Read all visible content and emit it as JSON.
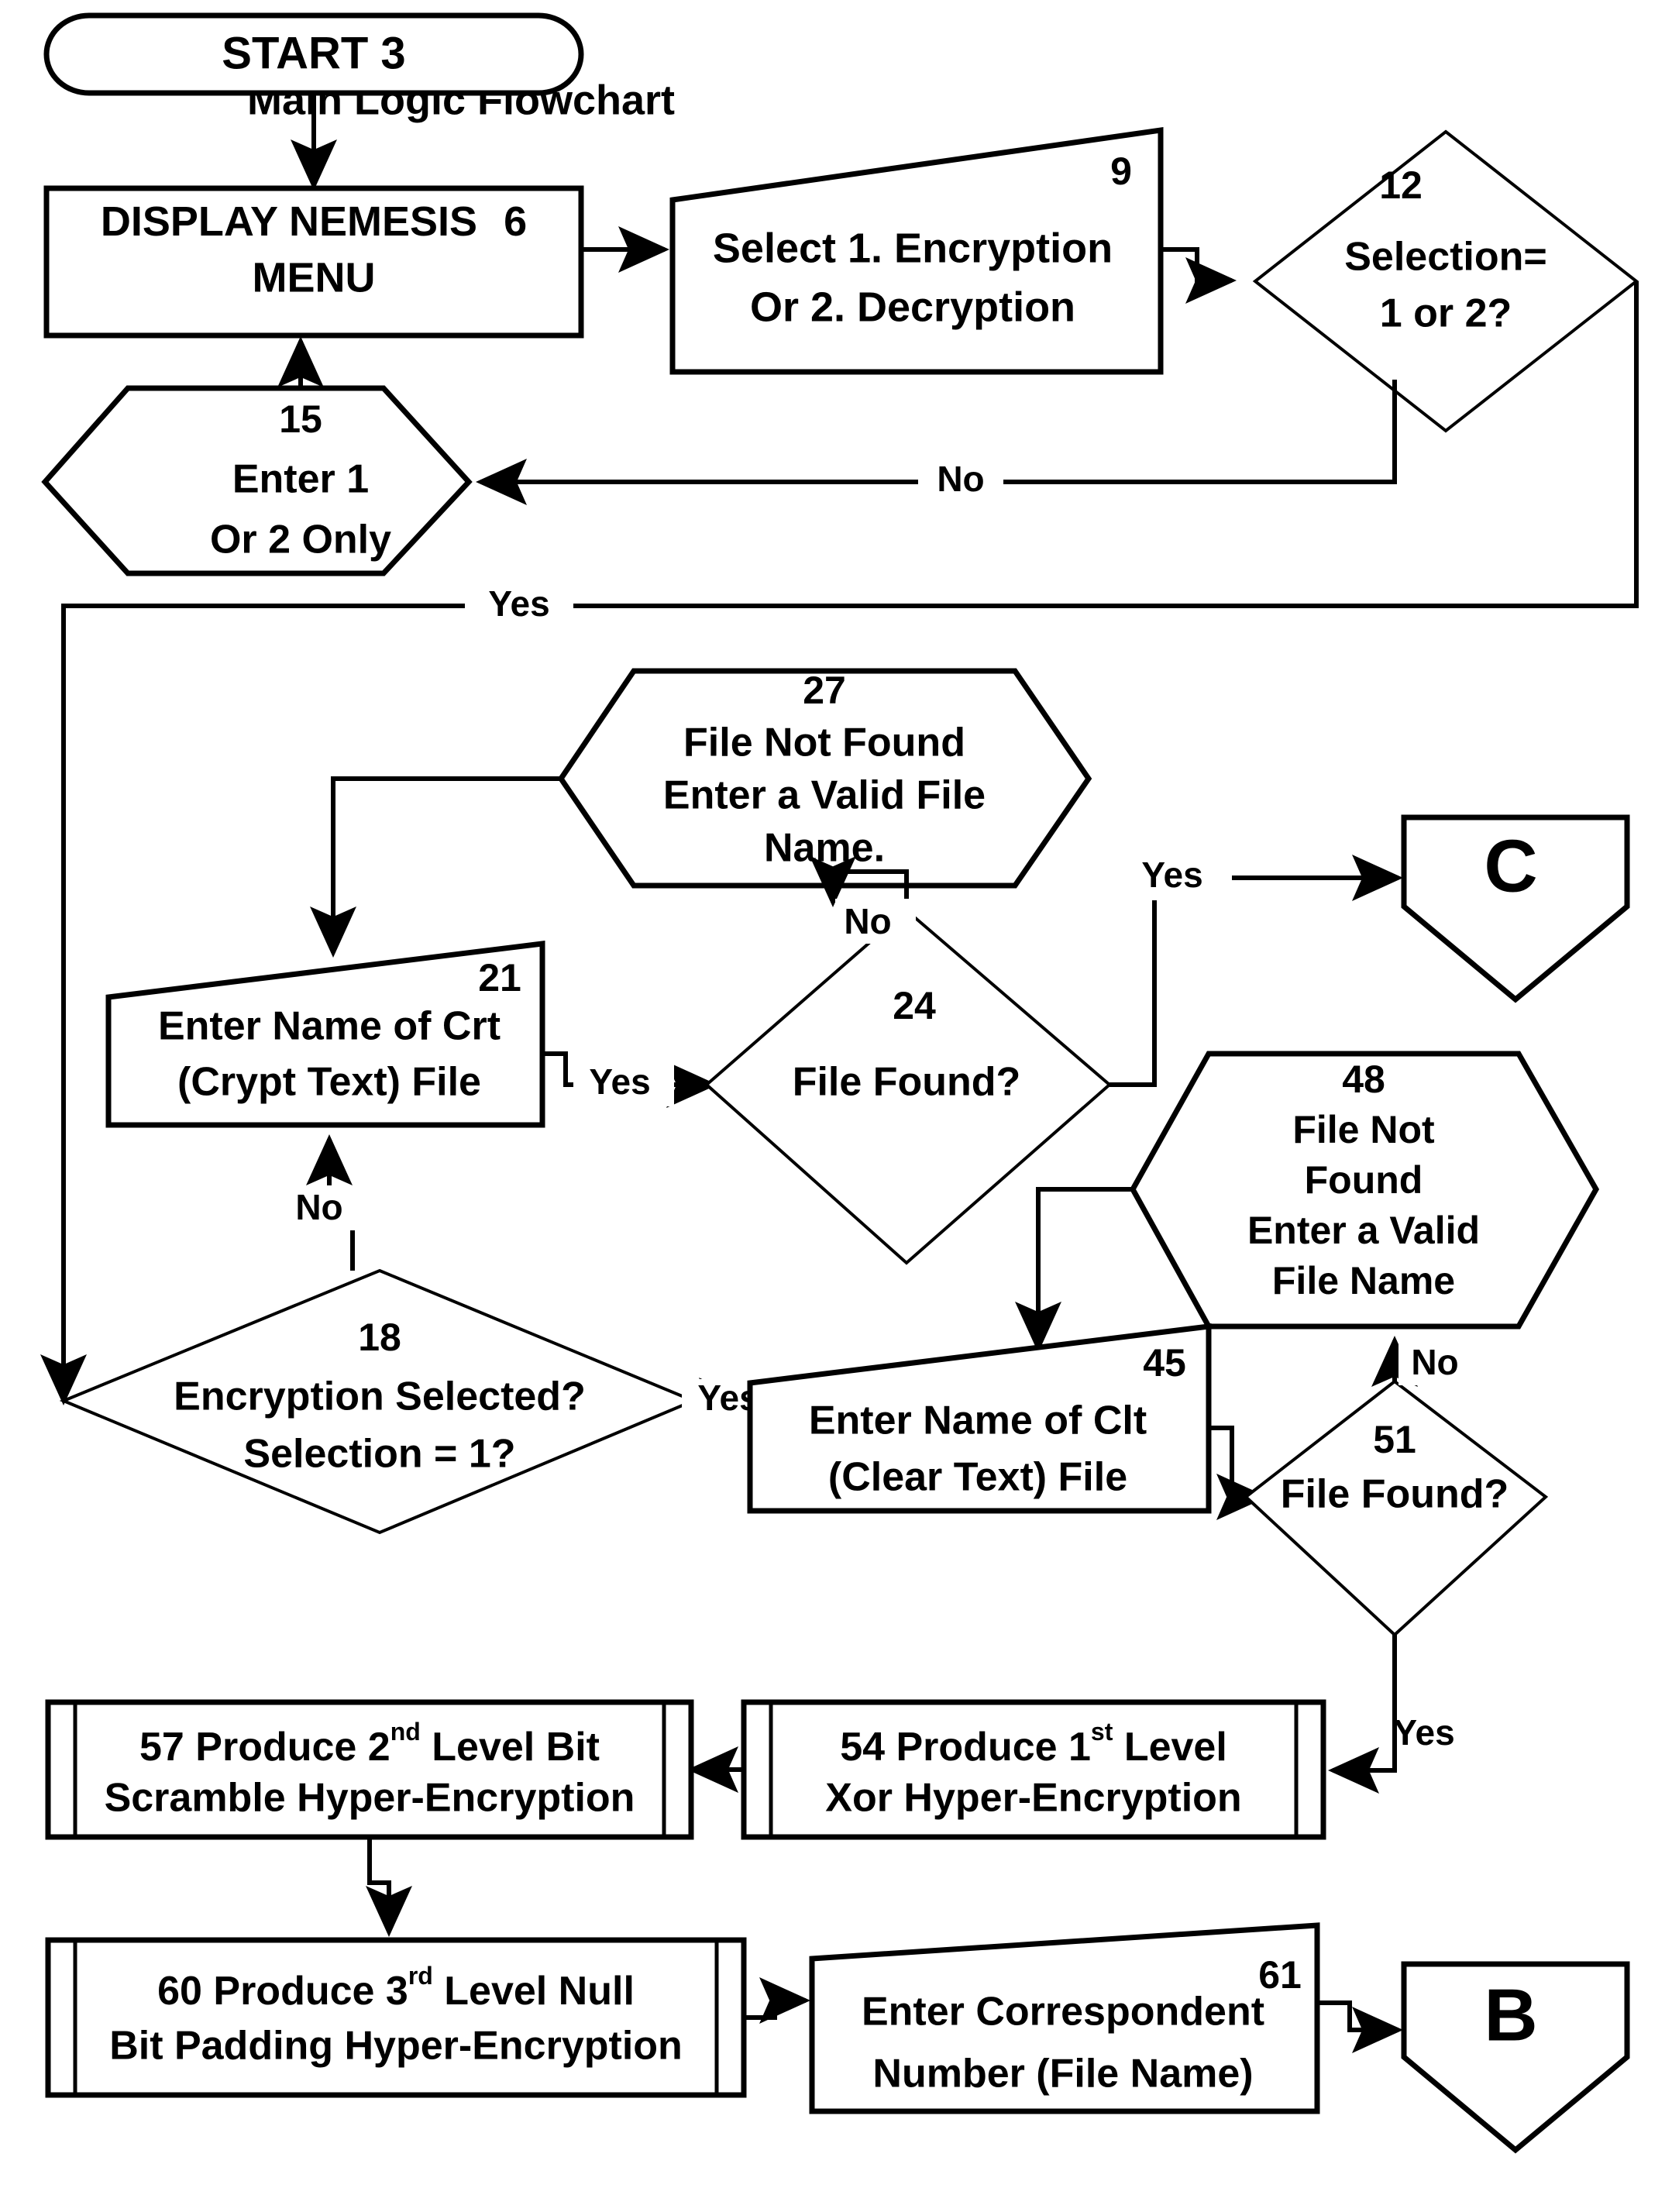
{
  "title": "Main Logic Flowchart",
  "chart_data": {
    "type": "diagram",
    "diagram_kind": "flowchart",
    "title": "Main Logic Flowchart",
    "nodes": [
      {
        "id": "3",
        "ref": "3",
        "shape": "terminator",
        "text": "START 3"
      },
      {
        "id": "6",
        "ref": "6",
        "shape": "process",
        "lines": [
          "DISPLAY NEMESIS   6",
          "MENU"
        ]
      },
      {
        "id": "9",
        "ref": "9",
        "shape": "manual-input",
        "lines": [
          "Select 1. Encryption",
          "Or 2. Decryption"
        ]
      },
      {
        "id": "12",
        "ref": "12",
        "shape": "decision",
        "lines": [
          "Selection=",
          "1 or 2?"
        ]
      },
      {
        "id": "15",
        "ref": "15",
        "shape": "hexagon",
        "lines": [
          "Enter 1",
          "Or 2 Only"
        ]
      },
      {
        "id": "27",
        "ref": "27",
        "shape": "hexagon",
        "lines": [
          "File Not Found",
          "Enter a Valid File",
          "Name."
        ]
      },
      {
        "id": "21",
        "ref": "21",
        "shape": "manual-input",
        "lines": [
          "Enter Name of Crt",
          "(Crypt Text) File"
        ]
      },
      {
        "id": "24",
        "ref": "24",
        "shape": "decision",
        "lines": [
          "File Found?"
        ]
      },
      {
        "id": "48",
        "ref": "48",
        "shape": "hexagon",
        "lines": [
          "File Not",
          "Found",
          "Enter a Valid",
          "File Name"
        ]
      },
      {
        "id": "18",
        "ref": "18",
        "shape": "decision",
        "lines": [
          "Encryption Selected?",
          "Selection = 1?"
        ]
      },
      {
        "id": "45",
        "ref": "45",
        "shape": "manual-input",
        "lines": [
          "Enter Name of Clt",
          "(Clear Text) File"
        ]
      },
      {
        "id": "51",
        "ref": "51",
        "shape": "decision",
        "lines": [
          "File Found?"
        ]
      },
      {
        "id": "57",
        "ref": "57",
        "shape": "predefined-process",
        "lines": [
          "57 Produce 2nd Level Bit",
          "Scramble Hyper-Encryption"
        ]
      },
      {
        "id": "54",
        "ref": "54",
        "shape": "predefined-process",
        "lines": [
          "54   Produce 1st Level",
          "Xor Hyper-Encryption"
        ]
      },
      {
        "id": "60",
        "ref": "60",
        "shape": "predefined-process",
        "lines": [
          "60   Produce 3rd Level Null",
          "Bit Padding Hyper-Encryption"
        ]
      },
      {
        "id": "61",
        "ref": "61",
        "shape": "manual-input",
        "lines": [
          "Enter Correspondent",
          "Number (File Name)"
        ]
      },
      {
        "id": "C",
        "ref": "C",
        "shape": "connector-offpage",
        "text": "C"
      },
      {
        "id": "B",
        "ref": "B",
        "shape": "connector-offpage",
        "text": "B"
      }
    ],
    "edges": [
      {
        "from": "3",
        "to": "6",
        "label": ""
      },
      {
        "from": "6",
        "to": "9",
        "label": ""
      },
      {
        "from": "9",
        "to": "12",
        "label": ""
      },
      {
        "from": "12",
        "to": "15",
        "label": "No"
      },
      {
        "from": "15",
        "to": "6",
        "label": ""
      },
      {
        "from": "12",
        "to": "18",
        "label": "Yes"
      },
      {
        "from": "18",
        "to": "21",
        "label": "No"
      },
      {
        "from": "21",
        "to": "24",
        "label": "Yes"
      },
      {
        "from": "24",
        "to": "27",
        "label": "No"
      },
      {
        "from": "27",
        "to": "21",
        "label": ""
      },
      {
        "from": "24",
        "to": "C",
        "label": "Yes"
      },
      {
        "from": "18",
        "to": "45",
        "label": "Yes"
      },
      {
        "from": "45",
        "to": "51",
        "label": ""
      },
      {
        "from": "51",
        "to": "48",
        "label": "No"
      },
      {
        "from": "48",
        "to": "45",
        "label": ""
      },
      {
        "from": "51",
        "to": "54",
        "label": "Yes"
      },
      {
        "from": "54",
        "to": "57",
        "label": ""
      },
      {
        "from": "57",
        "to": "60",
        "label": ""
      },
      {
        "from": "60",
        "to": "61",
        "label": ""
      },
      {
        "from": "61",
        "to": "B",
        "label": ""
      }
    ]
  },
  "nodes": {
    "start": {
      "num": "3",
      "text": "START 3"
    },
    "display_menu": {
      "num": "6",
      "line1": "DISPLAY NEMESIS",
      "num_inline": "6",
      "line2": "MENU"
    },
    "select_mode": {
      "num": "9",
      "line1": "Select 1. Encryption",
      "line2": "Or 2. Decryption"
    },
    "selection_check": {
      "num": "12",
      "line1": "Selection=",
      "line2": "1 or 2?"
    },
    "enter_only": {
      "num": "15",
      "line1": "Enter 1",
      "line2": "Or 2 Only"
    },
    "crt_not_found": {
      "num": "27",
      "line1": "File Not Found",
      "line2": "Enter a Valid File",
      "line3": "Name."
    },
    "enter_crt": {
      "num": "21",
      "line1": "Enter Name of Crt",
      "line2": "(Crypt Text) File"
    },
    "crt_found": {
      "num": "24",
      "line1": "File Found?"
    },
    "clt_not_found": {
      "num": "48",
      "line1": "File Not",
      "line2": "Found",
      "line3": "Enter a Valid",
      "line4": "File Name"
    },
    "encryption_selected": {
      "num": "18",
      "line1": "Encryption Selected?",
      "line2": "Selection = 1?"
    },
    "enter_clt": {
      "num": "45",
      "line1": "Enter Name of Clt",
      "line2": "(Clear Text) File"
    },
    "clt_found": {
      "num": "51",
      "line1": "File Found?"
    },
    "level2": {
      "num": "57",
      "l1a": "57 Produce 2",
      "l1sup": "nd",
      "l1b": " Level Bit",
      "line2": "Scramble Hyper-Encryption"
    },
    "level1": {
      "num": "54",
      "l1a": "54   Produce 1",
      "l1sup": "st",
      "l1b": " Level",
      "line2": "Xor Hyper-Encryption"
    },
    "level3": {
      "num": "60",
      "l1a": "60   Produce 3",
      "l1sup": "rd",
      "l1b": " Level Null",
      "line2": "Bit Padding Hyper-Encryption"
    },
    "enter_correspondent": {
      "num": "61",
      "line1": "Enter Correspondent",
      "line2": "Number (File Name)"
    },
    "connector_c": {
      "text": "C"
    },
    "connector_b": {
      "text": "B"
    }
  },
  "edge_labels": {
    "no_selection": "No",
    "yes_selection": "Yes",
    "no_encryption": "No",
    "yes_crt": "Yes",
    "no_crt_found": "No",
    "yes_crt_found": "Yes",
    "yes_encryption": "Yes",
    "no_clt_found": "No",
    "yes_clt_found": "Yes"
  },
  "colors": {
    "ink": "#000000",
    "paper": "#ffffff"
  }
}
